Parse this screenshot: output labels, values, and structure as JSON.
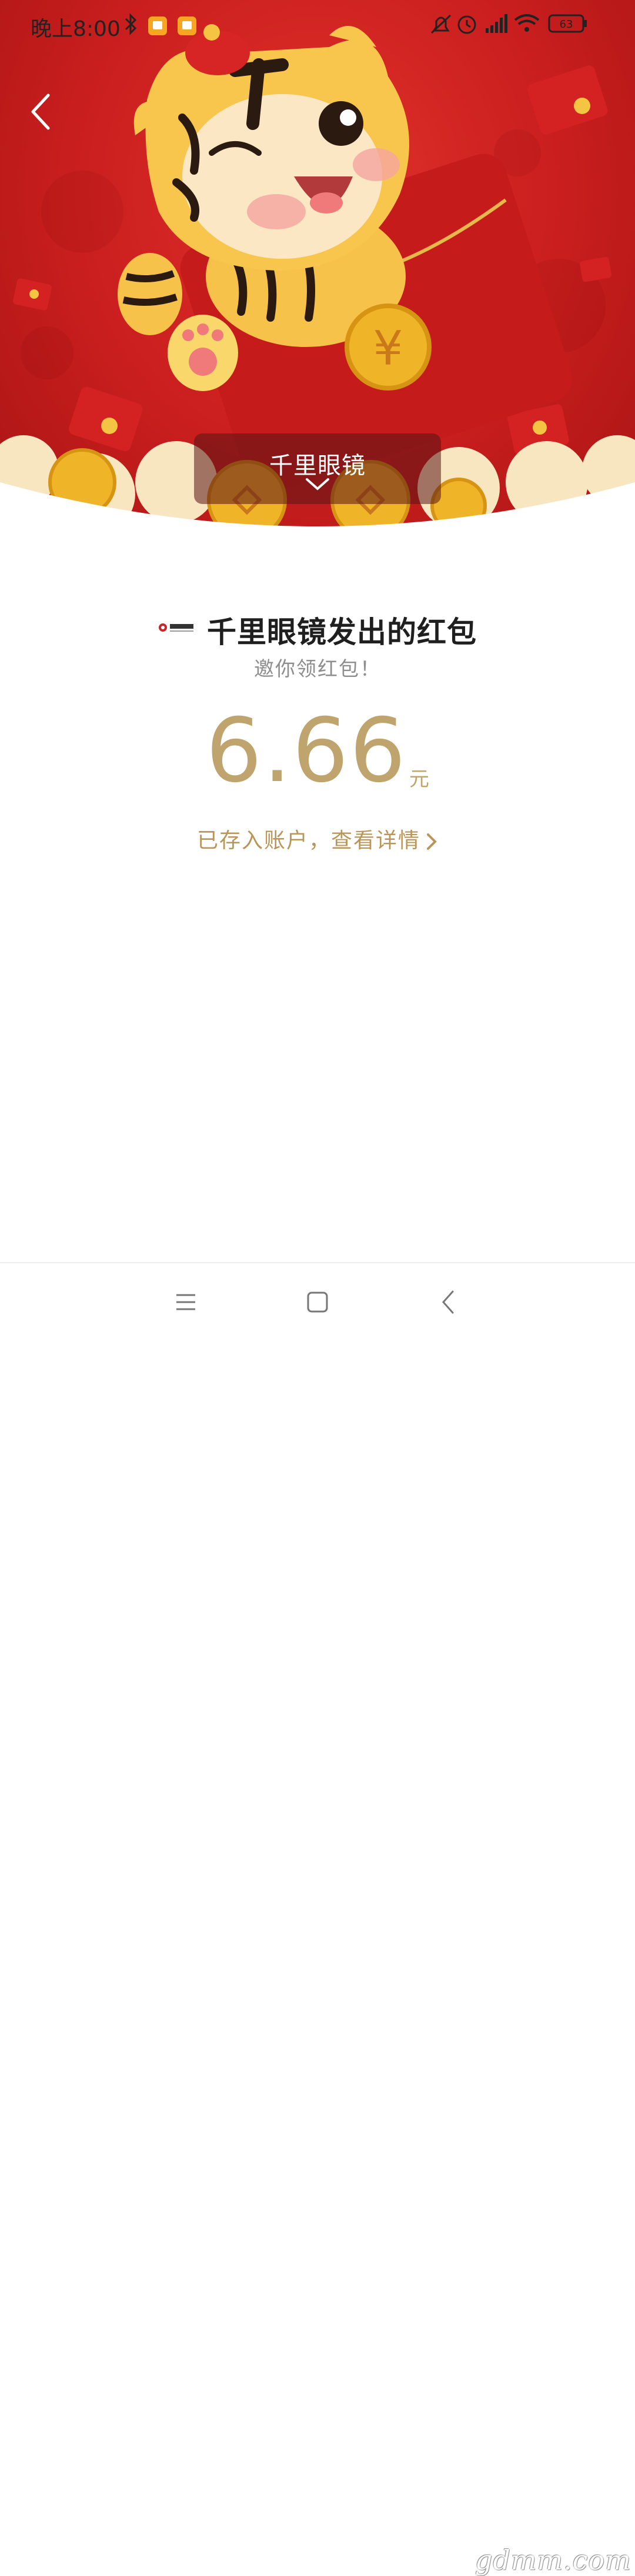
{
  "status_bar": {
    "time": "晚上8:00",
    "battery": "63",
    "icons": [
      "bluetooth-icon",
      "notification-app-icon",
      "notification-app-icon",
      "mute-bell-icon",
      "alarm-icon",
      "signal-icon",
      "wifi-icon",
      "battery-icon"
    ]
  },
  "hero": {
    "sender_banner": "千里眼镜",
    "illustration": "tiger-with-red-envelope"
  },
  "packet": {
    "title": "千里眼镜发出的红包",
    "greeting": "邀你领红包！",
    "amount": "6.66",
    "unit": "元",
    "details_link": "已存入账户，查看详情"
  },
  "watermark": "gdmm.com",
  "colors": {
    "hero_red": "#c91e1e",
    "gold": "#bfa46e",
    "link_gold": "#b8965a"
  }
}
